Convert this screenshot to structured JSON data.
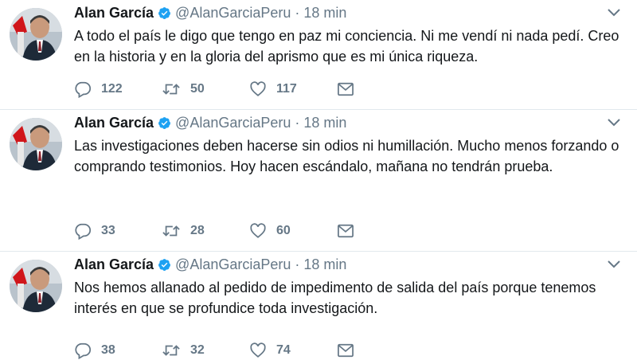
{
  "accent_color": "#1da1f2",
  "icons": {
    "verified": "verified-badge-icon",
    "caret": "chevron-down-icon",
    "reply": "reply-icon",
    "retweet": "retweet-icon",
    "like": "heart-icon",
    "dm": "envelope-icon"
  },
  "tweets": [
    {
      "name": "Alan García",
      "handle": "@AlanGarciaPeru",
      "separator": "·",
      "time": "18 min",
      "text": "A todo el país le digo que tengo en paz mi conciencia. Ni me vendí ni nada pedí. Creo en la historia y en la gloria del aprismo que es mi única riqueza.",
      "replies": "122",
      "retweets": "50",
      "likes": "117"
    },
    {
      "name": "Alan García",
      "handle": "@AlanGarciaPeru",
      "separator": "·",
      "time": "18 min",
      "text": "Las investigaciones deben hacerse sin odios ni humillación. Mucho menos forzando o comprando testimonios. Hoy hacen escándalo, mañana no tendrán prueba.",
      "replies": "33",
      "retweets": "28",
      "likes": "60"
    },
    {
      "name": "Alan García",
      "handle": "@AlanGarciaPeru",
      "separator": "·",
      "time": "18 min",
      "text": "Nos hemos allanado al pedido de impedimento de salida del país  porque tenemos interés en que se profundice toda investigación.",
      "replies": "38",
      "retweets": "32",
      "likes": "74"
    }
  ]
}
